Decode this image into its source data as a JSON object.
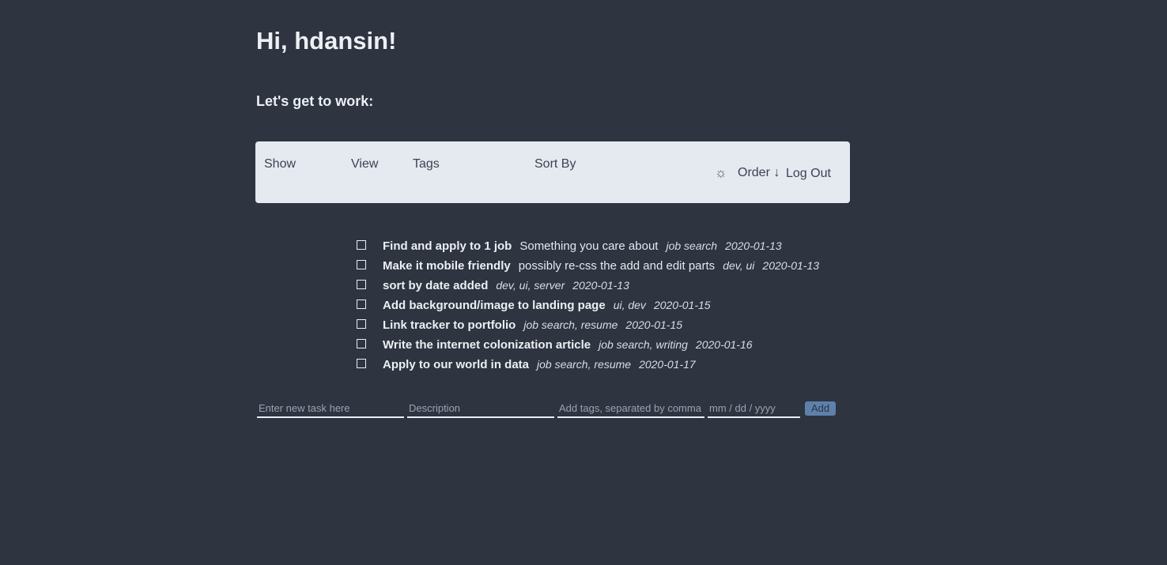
{
  "header": {
    "greeting": "Hi, hdansin!",
    "subheading": "Let's get to work:"
  },
  "toolbar": {
    "show_label": "Show",
    "view_label": "View",
    "tags_label": "Tags",
    "sort_label": "Sort By",
    "theme_icon": "☼",
    "order_label": "Order ↓",
    "logout_label": "Log Out"
  },
  "tasks": [
    {
      "title": "Find and apply to 1 job",
      "description": "Something you care about",
      "tags": "job search",
      "date": "2020-01-13"
    },
    {
      "title": "Make it mobile friendly",
      "description": "possibly re-css the add and edit parts",
      "tags": "dev, ui",
      "date": "2020-01-13"
    },
    {
      "title": "sort by date added",
      "description": "",
      "tags": "dev, ui, server",
      "date": "2020-01-13"
    },
    {
      "title": "Add background/image to landing page",
      "description": "",
      "tags": "ui, dev",
      "date": "2020-01-15"
    },
    {
      "title": "Link tracker to portfolio",
      "description": "",
      "tags": "job search, resume",
      "date": "2020-01-15"
    },
    {
      "title": "Write the internet colonization article",
      "description": "",
      "tags": "job search, writing",
      "date": "2020-01-16"
    },
    {
      "title": "Apply to our world in data",
      "description": "",
      "tags": "job search, resume",
      "date": "2020-01-17"
    }
  ],
  "add_form": {
    "task_placeholder": "Enter new task here",
    "description_placeholder": "Description",
    "tags_placeholder": "Add tags, separated by comma",
    "date_placeholder": "mm / dd / yyyy",
    "add_label": "Add"
  },
  "colors": {
    "background": "#2e3440",
    "toolbar": "#e5e9f0",
    "accent": "#5e81ac"
  }
}
